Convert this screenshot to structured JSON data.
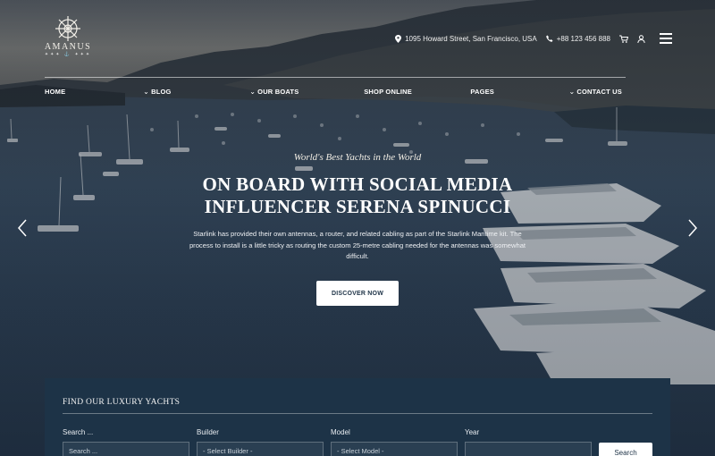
{
  "brand": {
    "name": "AMANUS",
    "tagline": "✦✦✦ ⚓ ✦✦✦"
  },
  "topbar": {
    "address": "1095 Howard Street, San Francisco, USA",
    "phone": "+88 123 456 888",
    "icons": [
      "location-pin-icon",
      "phone-icon",
      "cart-icon",
      "user-icon",
      "menu-icon"
    ]
  },
  "nav": {
    "items": [
      {
        "label": "HOME",
        "has_dropdown": true
      },
      {
        "label": "BLOG",
        "has_dropdown": true
      },
      {
        "label": "OUR BOATS",
        "has_dropdown": false
      },
      {
        "label": "SHOP ONLINE",
        "has_dropdown": false
      },
      {
        "label": "PAGES",
        "has_dropdown": true
      },
      {
        "label": "CONTACT US",
        "has_dropdown": false
      }
    ]
  },
  "hero": {
    "kicker": "World's Best Yachts in the World",
    "title_line1": "ON BOARD WITH SOCIAL MEDIA",
    "title_line2": "INFLUENCER SERENA SPINUCCI",
    "description": "Starlink has provided their own antennas, a router, and related cabling as part of the Starlink Maritime kit. The process to install is a little tricky as routing the custom 25-metre cabling needed for the antennas was somewhat difficult.",
    "cta_label": "DISCOVER NOW"
  },
  "search": {
    "title": "FIND OUR LUXURY YACHTS",
    "fields": [
      {
        "label": "Search ...",
        "value": "Search ..."
      },
      {
        "label": "Builder",
        "value": "- Select Builder -"
      },
      {
        "label": "Model",
        "value": "- Select Model -"
      },
      {
        "label": "Year",
        "value": ""
      }
    ],
    "button_label": "Search"
  },
  "colors": {
    "panel": "#1d3347",
    "button_text": "#1e3347"
  }
}
